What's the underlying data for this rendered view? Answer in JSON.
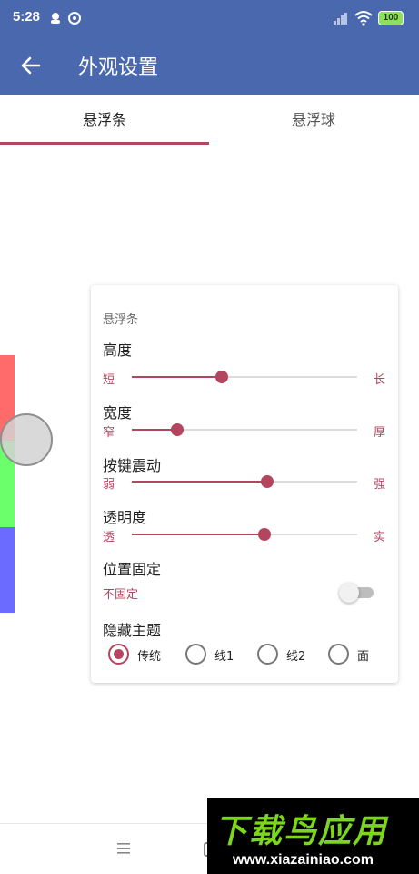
{
  "status_bar": {
    "time": "5:28",
    "battery": "100",
    "icons": [
      "notification-icon",
      "sync-icon",
      "signal-icon",
      "wifi-icon",
      "battery-icon"
    ]
  },
  "app_bar": {
    "title": "外观设置",
    "back_icon": "arrow-left-icon",
    "color": "#4a68ad"
  },
  "tabs": [
    {
      "label": "悬浮条",
      "selected": true
    },
    {
      "label": "悬浮球",
      "selected": false
    }
  ],
  "accent_color": "#b3455f",
  "preview": {
    "bar_colors": [
      "#ff6b6b",
      "#6bff6b",
      "#6b6bff"
    ]
  },
  "card": {
    "title": "悬浮条",
    "sliders": [
      {
        "label": "高度",
        "min_label": "短",
        "max_label": "长",
        "value": 0.4
      },
      {
        "label": "宽度",
        "min_label": "窄",
        "max_label": "厚",
        "value": 0.2
      },
      {
        "label": "按键震动",
        "min_label": "弱",
        "max_label": "强",
        "value": 0.6
      },
      {
        "label": "透明度",
        "min_label": "透",
        "max_label": "实",
        "value": 0.59
      }
    ],
    "fixed_position": {
      "label": "位置固定",
      "value_text": "不固定",
      "on": false
    },
    "hide_theme": {
      "label": "隐藏主题",
      "options": [
        "传统",
        "线1",
        "线2",
        "面"
      ],
      "selected": 0
    }
  },
  "watermark": {
    "text": "下载鸟应用",
    "url": "www.xiazainiao.com"
  }
}
